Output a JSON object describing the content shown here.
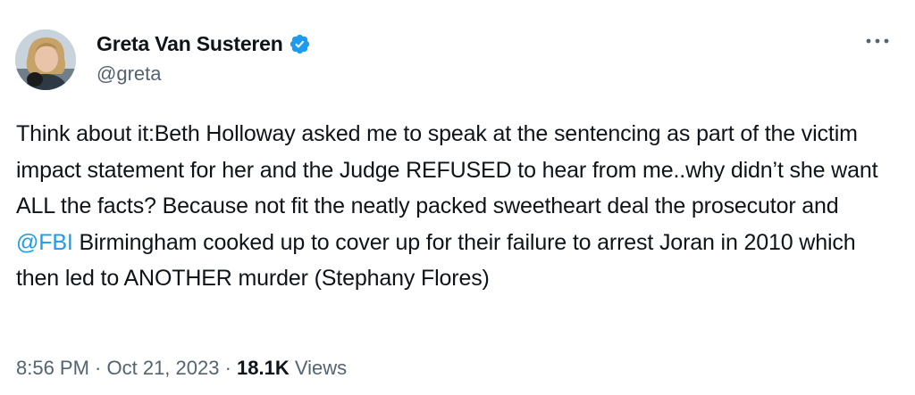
{
  "author": {
    "name": "Greta Van Susteren",
    "handle": "@greta",
    "verified_icon": "verified-badge-icon",
    "avatar_icon": "avatar-photo"
  },
  "menu": {
    "icon": "more-options-icon"
  },
  "tweet": {
    "text_part1": "Think about it:Beth Holloway asked me to speak at the sentencing as part of the victim impact statement for her and the Judge REFUSED to hear from me..why didn’t she want ALL the facts? Because not fit the neatly packed sweetheart deal the prosecutor and ",
    "mention": "@FBI",
    "text_part2": " Birmingham cooked up to cover up for their failure to arrest Joran in 2010 which then led to ANOTHER murder (Stephany Flores)"
  },
  "meta": {
    "time": "8:56 PM",
    "separator1": " · ",
    "date": "Oct 21, 2023",
    "separator2": " · ",
    "views_count": "18.1K",
    "views_label": " Views"
  },
  "colors": {
    "accent": "#1d9bf0",
    "text": "#0f1419",
    "secondary": "#536471"
  }
}
